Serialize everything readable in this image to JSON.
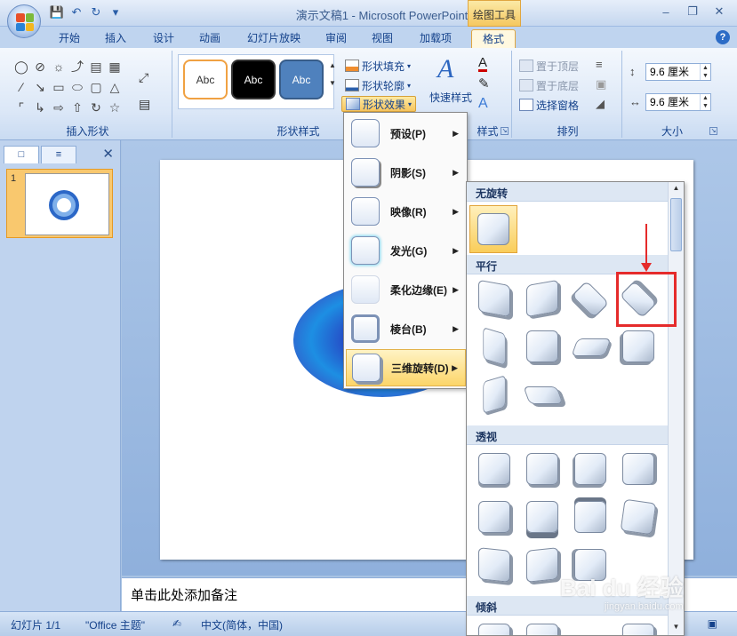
{
  "window": {
    "title": "演示文稿1 - Microsoft PowerPoint",
    "contextual_tools": "绘图工具"
  },
  "tabs": [
    "开始",
    "插入",
    "设计",
    "动画",
    "幻灯片放映",
    "审阅",
    "视图",
    "加载项",
    "格式"
  ],
  "active_tab": "格式",
  "ribbon": {
    "insert_shapes_label": "插入形状",
    "shape_styles_label": "形状样式",
    "style_samples": [
      "Abc",
      "Abc",
      "Abc"
    ],
    "fill": "形状填充",
    "outline": "形状轮廓",
    "effects": "形状效果",
    "quick_styles": "快速样式",
    "wordart_label_tail": "样式",
    "arrange_label": "排列",
    "bring_front": "置于顶层",
    "send_back": "置于底层",
    "selection_pane": "选择窗格",
    "size_label": "大小",
    "height": "9.6 厘米",
    "width": "9.6 厘米"
  },
  "left_panel": {
    "slide_number": "1"
  },
  "menu": {
    "items": [
      {
        "label": "预设(P)"
      },
      {
        "label": "阴影(S)"
      },
      {
        "label": "映像(R)"
      },
      {
        "label": "发光(G)"
      },
      {
        "label": "柔化边缘(E)"
      },
      {
        "label": "棱台(B)"
      },
      {
        "label": "三维旋转(D)"
      }
    ]
  },
  "gallery": {
    "sections": [
      "无旋转",
      "平行",
      "透视",
      "倾斜"
    ]
  },
  "notes_placeholder": "单击此处添加备注",
  "status": {
    "slide": "幻灯片 1/1",
    "theme": "\"Office 主题\"",
    "language": "中文(简体，中国)"
  },
  "watermark": {
    "brand": "Bai du 经验",
    "site": "jingyan.baidu.com"
  },
  "colors": {
    "accent_orange": "#f5b53f",
    "ring_blue": "#1d6fd1",
    "highlight_red": "#e52b2b"
  }
}
